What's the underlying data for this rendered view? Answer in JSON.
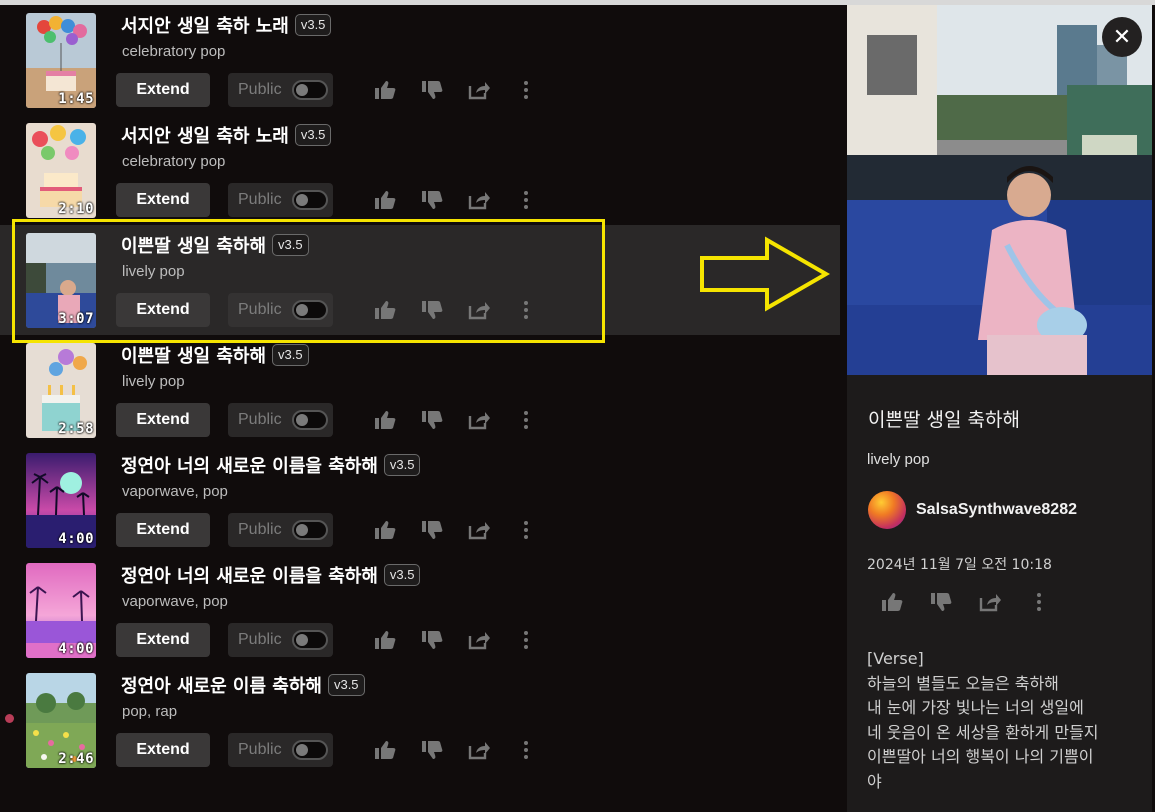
{
  "songs": [
    {
      "title": "서지안 생일 축하 노래",
      "version": "v3.5",
      "genre": "celebratory pop",
      "duration": "1:45",
      "thumb": "balloons-cake-desert"
    },
    {
      "title": "서지안 생일 축하 노래",
      "version": "v3.5",
      "genre": "celebratory pop",
      "duration": "2:10",
      "thumb": "balloons-cake-colorful"
    },
    {
      "title": "이쁜딸 생일 축하해",
      "version": "v3.5",
      "genre": "lively pop",
      "duration": "3:07",
      "thumb": "girl-tuktuk-photo"
    },
    {
      "title": "이쁜딸 생일 축하해",
      "version": "v3.5",
      "genre": "lively pop",
      "duration": "2:58",
      "thumb": "balloons-cake-candles"
    },
    {
      "title": "정연아 너의 새로운 이름을 축하해",
      "version": "v3.5",
      "genre": "vaporwave, pop",
      "duration": "4:00",
      "thumb": "vaporwave-palms-sun"
    },
    {
      "title": "정연아 너의 새로운 이름을 축하해",
      "version": "v3.5",
      "genre": "vaporwave, pop",
      "duration": "4:00",
      "thumb": "vaporwave-palms-lake"
    },
    {
      "title": "정연아 새로운 이름 축하해",
      "version": "v3.5",
      "genre": "pop, rap",
      "duration": "2:46",
      "thumb": "flower-field"
    }
  ],
  "labels": {
    "extend": "Extend",
    "public": "Public"
  },
  "icons": {
    "like": "thumbs-up-icon",
    "dislike": "thumbs-down-icon",
    "share": "share-icon",
    "more": "more-vertical-icon",
    "close": "close-icon"
  },
  "panel": {
    "close_glyph": "✕",
    "title": "이쁜딸 생일 축하해",
    "genre": "lively pop",
    "user": "SalsaSynthwave8282",
    "date": "2024년 11월 7일 오전 10:18",
    "lyrics": [
      "[Verse]",
      "하늘의 별들도 오늘은 축하해",
      "내 눈에 가장 빛나는 너의 생일에",
      "네 웃음이 온 세상을 환하게 만들지",
      "이쁜딸아 너의 행복이 나의 기쁨이",
      "야"
    ]
  },
  "colors": {
    "highlight": "#f5e400",
    "selected_row": "#2a2828",
    "background": "#100c0c",
    "panel": "#1d1b1b"
  }
}
